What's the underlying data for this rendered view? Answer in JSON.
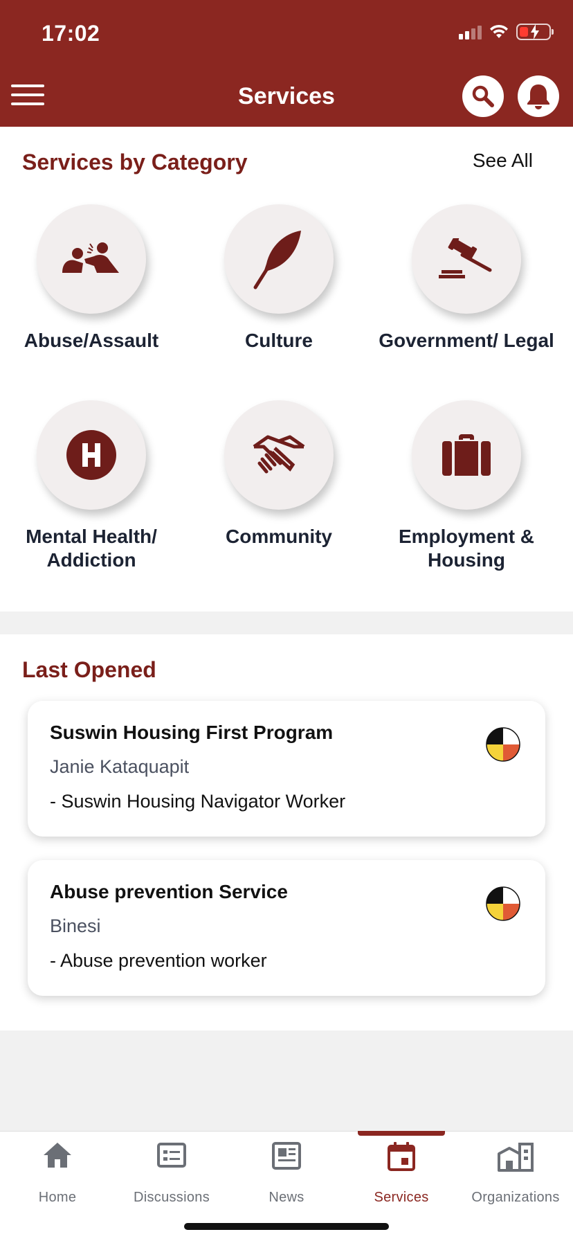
{
  "status_bar": {
    "time": "17:02"
  },
  "header": {
    "title": "Services"
  },
  "categories": {
    "title": "Services by Category",
    "see_all": "See All",
    "items": [
      {
        "label": "Abuse/Assault",
        "icon": "abuse-icon"
      },
      {
        "label": "Culture",
        "icon": "feather-icon"
      },
      {
        "label": "Government/ Legal",
        "icon": "gavel-icon"
      },
      {
        "label": "Mental Health/ Addiction",
        "icon": "hospital-icon"
      },
      {
        "label": "Community",
        "icon": "handshake-icon"
      },
      {
        "label": "Employment & Housing",
        "icon": "briefcase-icon"
      }
    ]
  },
  "last_opened": {
    "title": "Last Opened",
    "cards": [
      {
        "title": "Suswin Housing First Program",
        "person": "Janie Kataquapit",
        "role": "- Suswin Housing Navigator Worker"
      },
      {
        "title": "Abuse prevention Service",
        "person": "Binesi",
        "role": "- Abuse prevention worker"
      }
    ]
  },
  "nav": {
    "items": [
      {
        "label": "Home",
        "icon": "home-icon"
      },
      {
        "label": "Discussions",
        "icon": "discussions-icon"
      },
      {
        "label": "News",
        "icon": "news-icon"
      },
      {
        "label": "Services",
        "icon": "calendar-icon",
        "active": true
      },
      {
        "label": "Organizations",
        "icon": "buildings-icon"
      }
    ]
  },
  "colors": {
    "brand": "#8b2721",
    "icon": "#6e1d1a",
    "nav_inactive": "#6b6f76"
  }
}
